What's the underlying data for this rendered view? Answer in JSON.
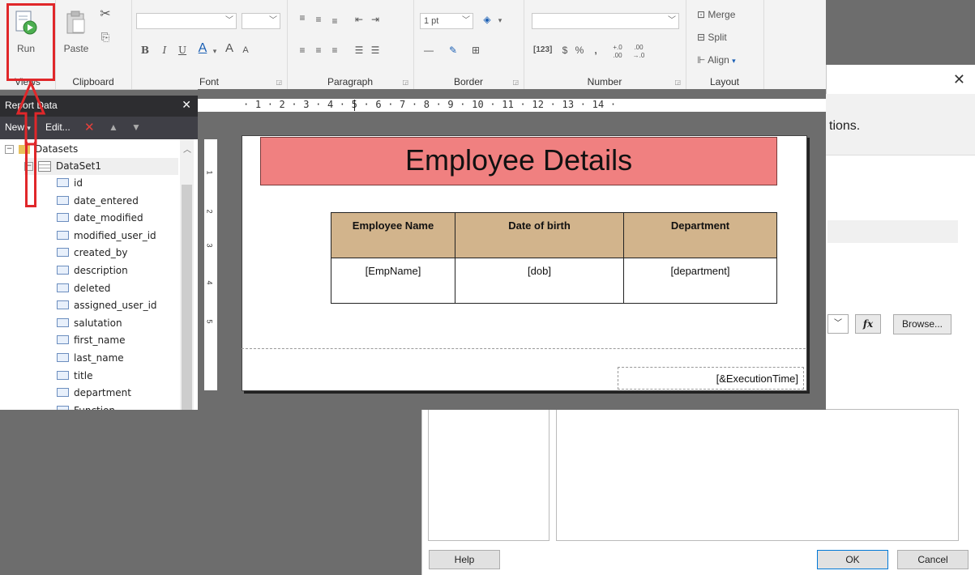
{
  "ribbon": {
    "views": {
      "run_label": "Run",
      "group_label": "Views"
    },
    "clipboard": {
      "paste_label": "Paste",
      "group_label": "Clipboard"
    },
    "font": {
      "group_label": "Font",
      "bold": "B",
      "italic": "I",
      "underline": "U",
      "font_color": "A",
      "grow": "A",
      "shrink": "A"
    },
    "paragraph": {
      "group_label": "Paragraph"
    },
    "border": {
      "group_label": "Border",
      "width_value": "1 pt"
    },
    "number": {
      "group_label": "Number",
      "currency": "$",
      "percent": "%",
      "comma": ",",
      "dec_inc": "+.0 .00",
      "dec_dec": ".00 →.0"
    },
    "layout": {
      "group_label": "Layout",
      "merge_label": "Merge",
      "split_label": "Split",
      "align_label": "Align"
    }
  },
  "report_data": {
    "title": "Report Data",
    "toolbar": {
      "new_label": "New",
      "edit_label": "Edit..."
    },
    "tree": {
      "root_label": "Datasets",
      "dataset_label": "DataSet1",
      "fields": [
        "id",
        "date_entered",
        "date_modified",
        "modified_user_id",
        "created_by",
        "description",
        "deleted",
        "assigned_user_id",
        "salutation",
        "first_name",
        "last_name",
        "title",
        "department",
        "Function"
      ]
    }
  },
  "ruler": {
    "top_text": "· 1 · 2 · 3 · 4 · 5 · 6 · 7 · 8 · 9 · 10 · 11 · 12 · 13 · 14 ·",
    "left_ticks": [
      "1",
      "2",
      "3",
      "4",
      "5"
    ]
  },
  "report": {
    "title": "Employee Details",
    "columns": [
      "Employee Name",
      "Date of birth",
      "Department"
    ],
    "row": [
      "[EmpName]",
      "[dob]",
      "[department]"
    ],
    "footer_text": "[&ExecutionTime]"
  },
  "dialog": {
    "header_text": "tions.",
    "fx_label": "fx",
    "browse_label": "Browse...",
    "help_label": "Help",
    "ok_label": "OK",
    "cancel_label": "Cancel",
    "close_glyph": "✕"
  },
  "colors": {
    "title_fill": "#f08080",
    "table_header_fill": "#d2b48c",
    "annotation_red": "#e0272a",
    "panel_dark": "#2d2d30"
  }
}
